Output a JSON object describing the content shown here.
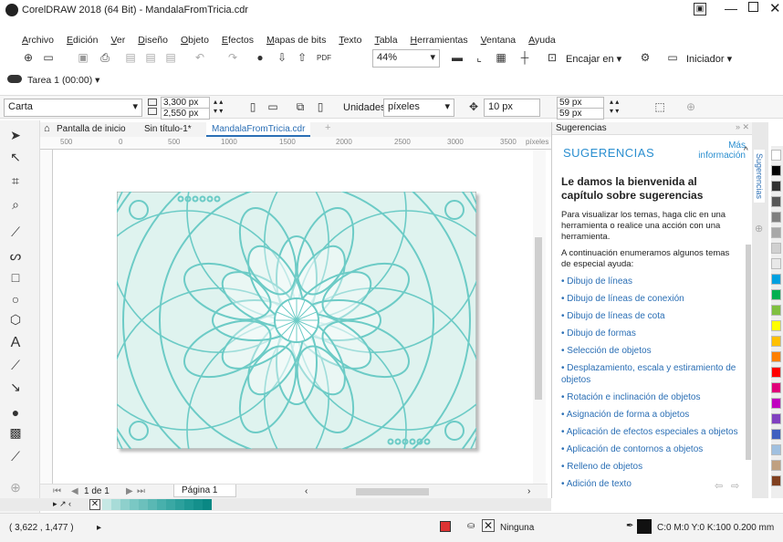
{
  "titlebar": {
    "title": "CorelDRAW 2018 (64 Bit) - MandalaFromTricia.cdr"
  },
  "menu": [
    "Archivo",
    "Edición",
    "Ver",
    "Diseño",
    "Objeto",
    "Efectos",
    "Mapas de bits",
    "Texto",
    "Tabla",
    "Herramientas",
    "Ventana",
    "Ayuda"
  ],
  "toolbar": {
    "zoom": "44%",
    "snap_label": "Encajar en",
    "launcher_label": "Iniciador"
  },
  "task": {
    "label": "Tarea 1 (00:00)"
  },
  "property_bar": {
    "page_preset": "Carta",
    "width": "3,300 px",
    "height": "2,550 px",
    "units_label": "Unidades:",
    "units_value": "píxeles",
    "nudge": "10 px",
    "dup_x": "59 px",
    "dup_y": "59 px"
  },
  "tabs": [
    "Pantalla de inicio",
    "Sin título-1*",
    "MandalaFromTricia.cdr"
  ],
  "ruler": {
    "ticks": [
      "500",
      "0",
      "500",
      "1000",
      "1500",
      "2000",
      "2500",
      "3000",
      "3500"
    ],
    "unit": "píxeles"
  },
  "docker": {
    "header": "Sugerencias",
    "title": "SUGERENCIAS",
    "more_info": "Más información",
    "heading": "Le damos la bienvenida al capítulo sobre sugerencias",
    "intro": "Para visualizar los temas, haga clic en una herramienta o realice una acción con una herramienta.",
    "list_intro": "A continuación enumeramos algunos temas de especial ayuda:",
    "links": [
      "Dibujo de líneas",
      "Dibujo de líneas de conexión",
      "Dibujo de líneas de cota",
      "Dibujo de formas",
      "Selección de objetos",
      "Desplazamiento, escala y estiramiento de objetos",
      "Rotación e inclinación de objetos",
      "Asignación de forma a objetos",
      "Aplicación de efectos especiales a objetos",
      "Aplicación de contornos a objetos",
      "Relleno de objetos",
      "Adición de texto"
    ],
    "side_tab": "Sugerencias"
  },
  "page_nav": {
    "counter": "1 de 1",
    "page_tab": "Página 1"
  },
  "status": {
    "coords": "( 3,622 , 1,477 )",
    "fill": "Ninguna",
    "outline": "C:0 M:0 Y:0 K:100  0.200 mm"
  },
  "palette": [
    "#ffffff",
    "#000000",
    "#303030",
    "#585858",
    "#808080",
    "#a8a8a8",
    "#d0d0d0",
    "#e8e8e8",
    "#00a0e0",
    "#00b050",
    "#80c040",
    "#ffff00",
    "#ffc000",
    "#ff8000",
    "#ff0000",
    "#e0007a",
    "#c000c0",
    "#8040c0",
    "#4060c0",
    "#a0c0e0",
    "#c0a080",
    "#804020"
  ],
  "doc_palette": [
    "#c6e8e4",
    "#a8dcd8",
    "#8ed0cc",
    "#7ac8c4",
    "#6cc0bc",
    "#5ab8b4",
    "#48b0ac",
    "#3aa8a4",
    "#2ca09c",
    "#1e9894",
    "#14908c",
    "#0a8884"
  ],
  "mandala": {
    "fill": "#dff3ef",
    "line": "#6ccbc6"
  }
}
